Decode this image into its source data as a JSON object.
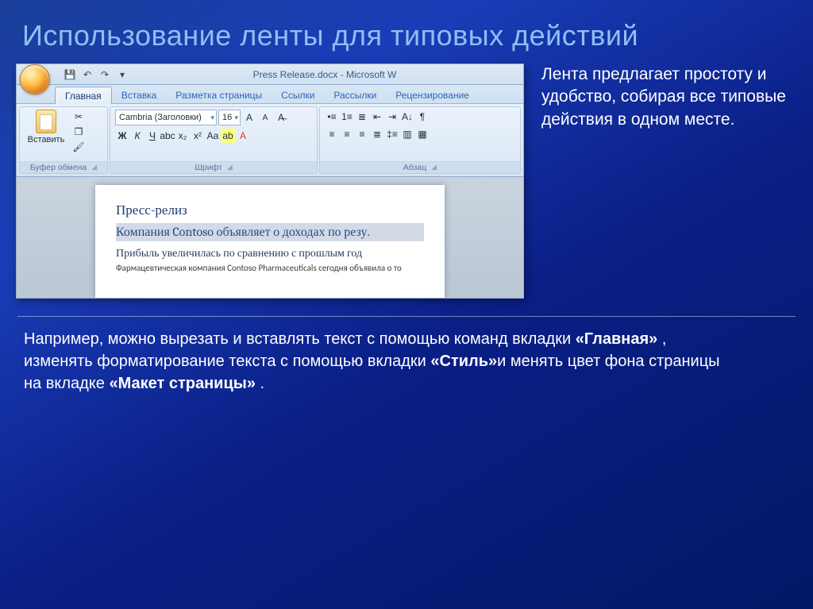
{
  "slide": {
    "title": "Использование ленты для типовых действий",
    "side_text": "Лента предлагает простоту и удобство, собирая все типовые действия в одном месте.",
    "bottom_parts": {
      "t1": "Например, можно вырезать и вставлять текст с помощью команд вкладки ",
      "b1": "«Главная»",
      "t2": " , изменять форматирование текста с помощью вкладки ",
      "b2": "«Стиль»",
      "t3": "и менять цвет фона страницы на вкладке ",
      "b3": "«Макет страницы»",
      "t4": " ."
    }
  },
  "word": {
    "window_title": "Press Release.docx - Microsoft W",
    "qat": {
      "save": "💾",
      "undo": "↶",
      "redo": "↷",
      "more": "▾"
    },
    "tabs": [
      "Главная",
      "Вставка",
      "Разметка страницы",
      "Ссылки",
      "Рассылки",
      "Рецензирование"
    ],
    "active_tab": 0,
    "groups": {
      "clipboard": {
        "label": "Буфер обмена",
        "paste": "Вставить"
      },
      "font": {
        "label": "Шрифт",
        "font_name": "Cambria (Заголовки)",
        "font_size": "16"
      },
      "paragraph": {
        "label": "Абзац"
      }
    },
    "doc": {
      "l1": "Пресс-релиз",
      "l2": "Компания Contoso объявляет о доходах по резу.",
      "l3": "Прибыль увеличилась по сравнению с прошлым год",
      "l4": "Фармацевтическая компания Contoso Pharmaceuticals сегодня объявила о то"
    }
  }
}
